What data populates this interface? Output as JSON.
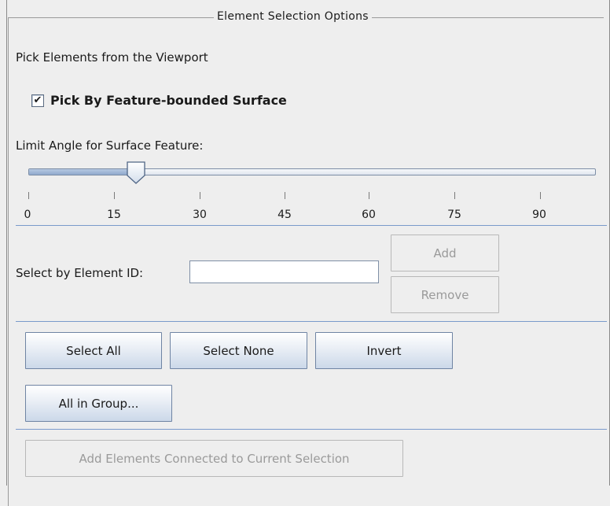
{
  "panel": {
    "title": "Element Selection Options"
  },
  "pick": {
    "heading": "Pick Elements from the Viewport",
    "checkbox_label": "Pick By Feature-bounded Surface",
    "checkbox_checked": true,
    "checkbox_mark": "✔"
  },
  "angle": {
    "label": "Limit Angle for Surface Feature:",
    "value": 20,
    "min": 0,
    "max": 100,
    "ticks": [
      "0",
      "15",
      "30",
      "45",
      "60",
      "75",
      "90"
    ]
  },
  "element_id": {
    "label": "Select by Element  ID:",
    "value": "",
    "add_label": "Add",
    "remove_label": "Remove"
  },
  "selection": {
    "select_all": "Select All",
    "select_none": "Select None",
    "invert": "Invert",
    "all_in_group": "All in Group..."
  },
  "connected": {
    "button_label": "Add Elements Connected to Current Selection"
  },
  "colors": {
    "separator": "#7a9acb",
    "button_border": "#6f84a3",
    "disabled_text": "#9a9a9a"
  }
}
